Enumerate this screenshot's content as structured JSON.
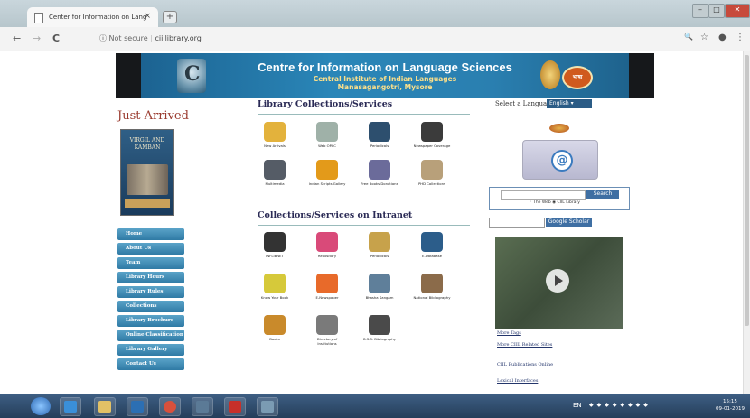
{
  "browser": {
    "tab_title": "Center for Information on Lang",
    "tab_close": "×",
    "new_tab": "+",
    "back": "←",
    "forward": "→",
    "reload": "C",
    "info_icon": "ⓘ",
    "security": "Not secure",
    "separator": "|",
    "url": "ciillibrary.org",
    "zoom_icon": "🔍",
    "star_icon": "☆",
    "profile_icon": "●",
    "menu_icon": "⋮",
    "win_min": "–",
    "win_max": "□",
    "win_close": "✕"
  },
  "banner": {
    "logo_letter": "C",
    "title": "Centre for Information on Language Sciences",
    "line2": "Central Institute of Indian Languages",
    "line3": "Manasagangotri, Mysore",
    "badge": "भाषा"
  },
  "left": {
    "heading": "Just Arrived",
    "book_title": "VIRGIL AND KAMBAN",
    "menu": [
      "Home",
      "About Us",
      "Team",
      "Library Hours",
      "Library Rules",
      "Collections",
      "Library Brochure",
      "Online Classification",
      "Library Gallery",
      "Contact Us"
    ]
  },
  "middle": {
    "heading1": "Library Collections/Services",
    "services1": [
      {
        "label": "New Arrivals",
        "color": "#e3b23c"
      },
      {
        "label": "Web OPAC",
        "color": "#9fb1a8"
      },
      {
        "label": "Periodicals",
        "color": "#2d4f6e"
      },
      {
        "label": "Newspaper Coverage",
        "color": "#3b3b3b"
      },
      {
        "label": "Multimedia",
        "color": "#555c66"
      },
      {
        "label": "Indian Scripts Gallery",
        "color": "#e39a1a"
      },
      {
        "label": "Free Books Donations",
        "color": "#6b6b9a"
      },
      {
        "label": "PHD Collections",
        "color": "#b8a07a"
      }
    ],
    "heading2": "Collections/Services on Intranet",
    "services2": [
      {
        "label": "INFLIBNET",
        "color": "#333"
      },
      {
        "label": "Repository",
        "color": "#d94a79"
      },
      {
        "label": "Periodicals",
        "color": "#c7a24b"
      },
      {
        "label": "E-Database",
        "color": "#2c5d8a"
      },
      {
        "label": "Know Your Book",
        "color": "#d6c93a"
      },
      {
        "label": "E-Newspaper",
        "color": "#e86a2a"
      },
      {
        "label": "Bhasha Sangam",
        "color": "#5f7f9a"
      },
      {
        "label": "National Bibliography",
        "color": "#8b6b4a"
      },
      {
        "label": "Books",
        "color": "#c98a2b"
      },
      {
        "label": "Directory of Institutions",
        "color": "#7a7a7a"
      },
      {
        "label": "B.S.S. Bibliography",
        "color": "#4a4a4a"
      }
    ]
  },
  "right": {
    "select_label": "Select a Language",
    "select_value": "English ▾",
    "search_button": "Search",
    "search_options": "◦ The Web ◉ CIIL Library",
    "scholar_button": "Google Scholar",
    "links": [
      "More Tags",
      "More CIIL Related Sites",
      "CIIL Publications Online",
      "Lexical Interfaces"
    ]
  },
  "taskbar": {
    "lang": "EN",
    "time": "15:15",
    "date": "09-01-2019"
  }
}
